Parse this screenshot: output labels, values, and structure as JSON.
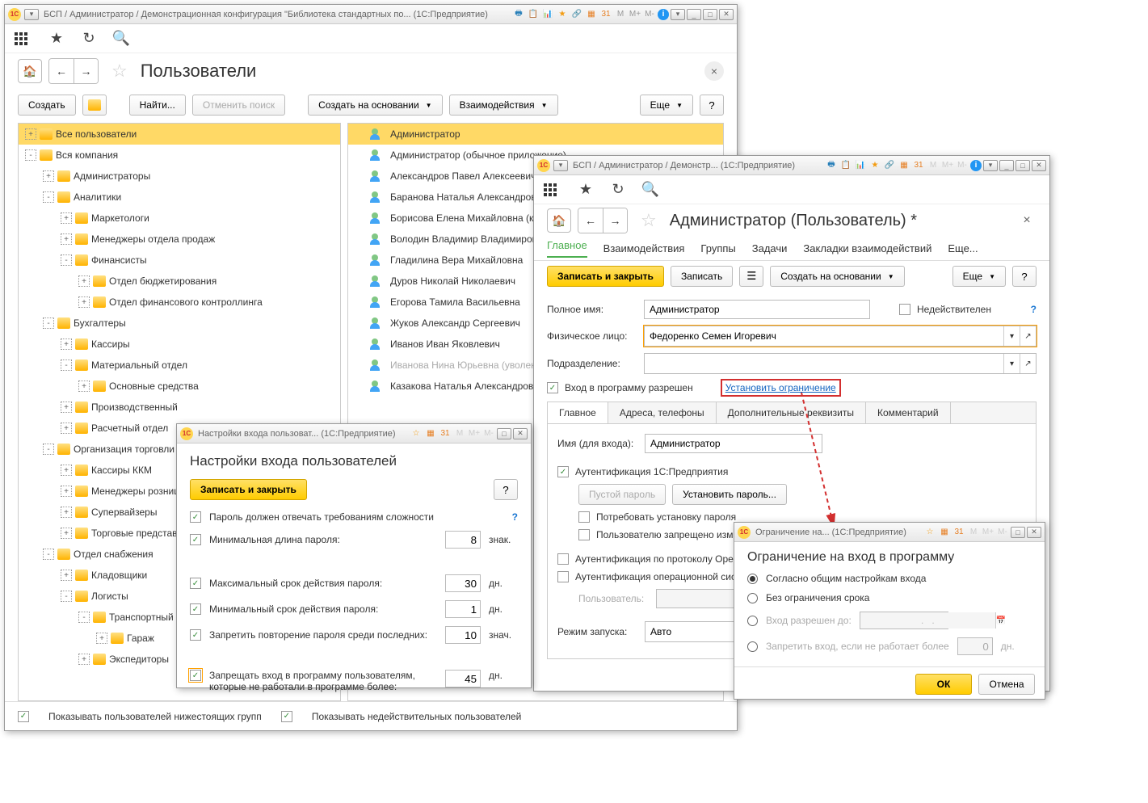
{
  "main": {
    "title": "БСП / Администратор / Демонстрационная конфигурация \"Библиотека стандартных по...  (1С:Предприятие)",
    "page_heading": "Пользователи",
    "actions": {
      "create": "Создать",
      "find": "Найти...",
      "cancel_search": "Отменить поиск",
      "create_based": "Создать на основании",
      "interactions": "Взаимодействия",
      "more": "Еще"
    },
    "tree": [
      {
        "label": "Все пользователи",
        "sel": true,
        "depth": 0,
        "exp": "+"
      },
      {
        "label": "Вся компания",
        "depth": 0,
        "exp": "-"
      },
      {
        "label": "Администраторы",
        "depth": 1,
        "exp": "+"
      },
      {
        "label": "Аналитики",
        "depth": 1,
        "exp": "-"
      },
      {
        "label": "Маркетологи",
        "depth": 2,
        "exp": "+"
      },
      {
        "label": "Менеджеры отдела продаж",
        "depth": 2,
        "exp": "+"
      },
      {
        "label": "Финансисты",
        "depth": 2,
        "exp": "-"
      },
      {
        "label": "Отдел бюджетирования",
        "depth": 3,
        "exp": "+"
      },
      {
        "label": "Отдел финансового контроллинга",
        "depth": 3,
        "exp": "+"
      },
      {
        "label": "Бухгалтеры",
        "depth": 1,
        "exp": "-"
      },
      {
        "label": "Кассиры",
        "depth": 2,
        "exp": "+"
      },
      {
        "label": "Материальный отдел",
        "depth": 2,
        "exp": "-"
      },
      {
        "label": "Основные средства",
        "depth": 3,
        "exp": "+"
      },
      {
        "label": "Производственный",
        "depth": 2,
        "exp": "+"
      },
      {
        "label": "Расчетный отдел",
        "depth": 2,
        "exp": "+"
      },
      {
        "label": "Организация торговли",
        "depth": 1,
        "exp": "-"
      },
      {
        "label": "Кассиры ККМ",
        "depth": 2,
        "exp": "+"
      },
      {
        "label": "Менеджеры розницы",
        "depth": 2,
        "exp": "+"
      },
      {
        "label": "Супервайзеры",
        "depth": 2,
        "exp": "+"
      },
      {
        "label": "Торговые представители",
        "depth": 2,
        "exp": "+"
      },
      {
        "label": "Отдел снабжения",
        "depth": 1,
        "exp": "-"
      },
      {
        "label": "Кладовщики",
        "depth": 2,
        "exp": "+"
      },
      {
        "label": "Логисты",
        "depth": 2,
        "exp": "-"
      },
      {
        "label": "Транспортный",
        "depth": 3,
        "exp": "-"
      },
      {
        "label": "Гараж",
        "depth": 4,
        "exp": "+"
      },
      {
        "label": "Экспедиторы",
        "depth": 3,
        "exp": "+"
      }
    ],
    "list": [
      {
        "name": "Администратор",
        "sel": true
      },
      {
        "name": "Администратор (обычное приложение)"
      },
      {
        "name": "Александров Павел Алексеевич"
      },
      {
        "name": "Баранова Наталья Александровна"
      },
      {
        "name": "Борисова Елена Михайловна (кадровик)"
      },
      {
        "name": "Володин Владимир Владимирович"
      },
      {
        "name": "Гладилина Вера Михайловна"
      },
      {
        "name": "Дуров Николай Николаевич"
      },
      {
        "name": "Егорова Тамила Васильевна"
      },
      {
        "name": "Жуков Александр Сергеевич"
      },
      {
        "name": "Иванов Иван Яковлевич"
      },
      {
        "name": "Иванова Нина Юрьевна (уволена)",
        "fired": true
      },
      {
        "name": "Казакова Наталья Александровна"
      }
    ],
    "footer": {
      "show_sub": "Показывать пользователей нижестоящих групп",
      "show_inactive": "Показывать недействительных пользователей"
    },
    "tb_m": [
      "M",
      "M+",
      "M-"
    ]
  },
  "user": {
    "title": "БСП / Администратор / Демонстр...  (1С:Предприятие)",
    "heading": "Администратор (Пользователь) *",
    "tabs": [
      "Главное",
      "Взаимодействия",
      "Группы",
      "Задачи",
      "Закладки взаимодействий",
      "Еще..."
    ],
    "save_close": "Записать и закрыть",
    "save": "Записать",
    "create_based": "Создать на основании",
    "more": "Еще",
    "labels": {
      "fullname": "Полное имя:",
      "person": "Физическое лицо:",
      "dept": "Подразделение:",
      "inactive": "Недействителен",
      "login_allowed": "Вход в программу разрешен",
      "set_limit": "Установить ограничение"
    },
    "values": {
      "fullname": "Администратор",
      "person": "Федоренко Семен Игоревич",
      "login_name": "Администратор",
      "launch_mode": "Авто"
    },
    "subtabs": [
      "Главное",
      "Адреса, телефоны",
      "Дополнительные реквизиты",
      "Комментарий"
    ],
    "sub": {
      "login_label": "Имя (для входа):",
      "auth1c": "Аутентификация 1С:Предприятия",
      "empty_pwd": "Пустой пароль",
      "set_pwd": "Установить пароль...",
      "require_pwd": "Потребовать установку пароля",
      "deny_pwd": "Пользователю запрещено изменять",
      "auth_proto": "Аутентификация по протоколу OpenID",
      "auth_os": "Аутентификация операционной системы",
      "os_user": "Пользователь:",
      "launch": "Режим запуска:"
    },
    "tb_m": [
      "M",
      "M+",
      "M-"
    ]
  },
  "settings": {
    "title": "Настройки входа пользоват...  (1С:Предприятие)",
    "heading": "Настройки входа пользователей",
    "save_close": "Записать и закрыть",
    "rows": {
      "complexity": "Пароль должен отвечать требованиям сложности",
      "min_len": "Минимальная длина пароля:",
      "min_len_v": "8",
      "min_len_u": "знак.",
      "max_age": "Максимальный срок действия пароля:",
      "max_age_v": "30",
      "max_age_u": "дн.",
      "min_age": "Минимальный срок действия пароля:",
      "min_age_v": "1",
      "min_age_u": "дн.",
      "deny_repeat": "Запретить повторение пароля среди последних:",
      "deny_repeat_v": "10",
      "deny_repeat_u": "знач.",
      "deny_inactive1": "Запрещать вход в программу пользователям,",
      "deny_inactive2": "которые не работали в программе более:",
      "deny_inactive_v": "45",
      "deny_inactive_u": "дн."
    },
    "tb_m": [
      "M",
      "M+",
      "M-"
    ]
  },
  "limit": {
    "title": "Ограничение на...  (1С:Предприятие)",
    "heading": "Ограничение на вход в программу",
    "opt1": "Согласно общим настройкам входа",
    "opt2": "Без ограничения срока",
    "opt3": "Вход разрешен до:",
    "opt4": "Запретить вход, если не работает более",
    "opt4_v": "0",
    "opt4_u": "дн.",
    "ok": "ОК",
    "cancel": "Отмена",
    "tb_m": [
      "M",
      "M+",
      "M-"
    ]
  }
}
